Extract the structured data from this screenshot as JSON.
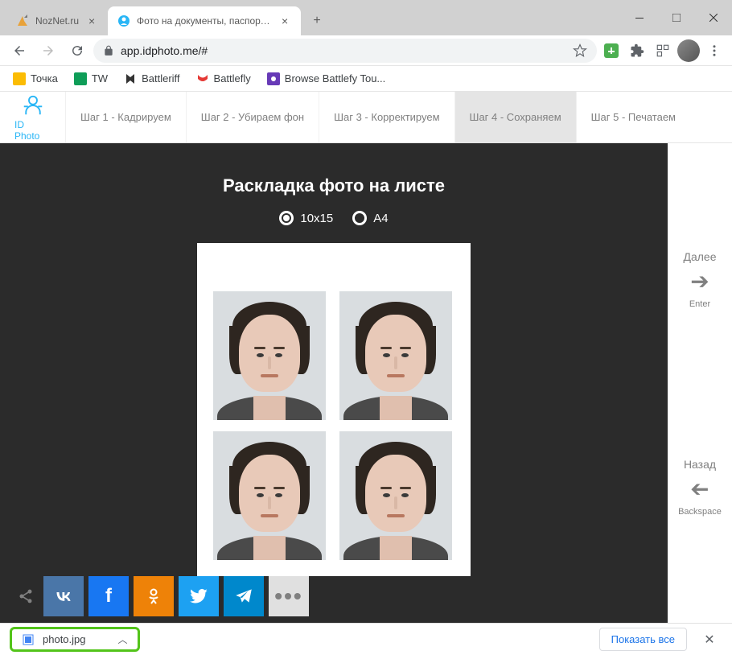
{
  "tabs": [
    {
      "title": "NozNet.ru"
    },
    {
      "title": "Фото на документы, паспорта,"
    }
  ],
  "url": "app.idphoto.me/#",
  "bookmarks": [
    {
      "label": "Точка"
    },
    {
      "label": "TW"
    },
    {
      "label": "Battleriff"
    },
    {
      "label": "Battlefly"
    },
    {
      "label": "Browse Battlefy Tou..."
    }
  ],
  "brand": "ID Photo",
  "steps": [
    {
      "label": "Шаг 1 - Кадрируем"
    },
    {
      "label": "Шаг 2 - Убираем фон"
    },
    {
      "label": "Шаг 3 - Корректируем"
    },
    {
      "label": "Шаг 4 - Сохраняем"
    },
    {
      "label": "Шаг 5 - Печатаем"
    }
  ],
  "canvas": {
    "title": "Раскладка фото на листе",
    "opt1": "10x15",
    "opt2": "A4"
  },
  "side": {
    "next": "Далее",
    "next_key": "Enter",
    "back": "Назад",
    "back_key": "Backspace"
  },
  "download": {
    "filename": "photo.jpg",
    "showall": "Показать все"
  }
}
